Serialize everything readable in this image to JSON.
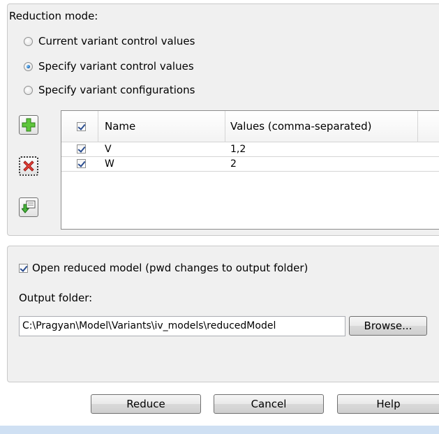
{
  "reduction": {
    "title": "Reduction mode:",
    "options": [
      {
        "label": "Current variant control values",
        "selected": false
      },
      {
        "label": "Specify variant control values",
        "selected": true
      },
      {
        "label": "Specify variant configurations",
        "selected": false
      }
    ]
  },
  "tools": {
    "add_icon": "plus-icon",
    "delete_icon": "red-x-icon",
    "import_icon": "import-icon"
  },
  "table": {
    "header_checked": true,
    "columns": [
      "Name",
      "Values (comma-separated)"
    ],
    "rows": [
      {
        "checked": true,
        "name": "V",
        "values": "1,2"
      },
      {
        "checked": true,
        "name": "W",
        "values": "2"
      }
    ]
  },
  "options": {
    "open_reduced_label": "Open reduced model (pwd changes to output folder)",
    "open_reduced_checked": true,
    "output_label": "Output folder:",
    "output_value": "C:\\Pragyan\\Model\\Variants\\iv_models\\reducedModel",
    "browse_label": "Browse..."
  },
  "buttons": {
    "reduce": "Reduce",
    "cancel": "Cancel",
    "help": "Help"
  }
}
